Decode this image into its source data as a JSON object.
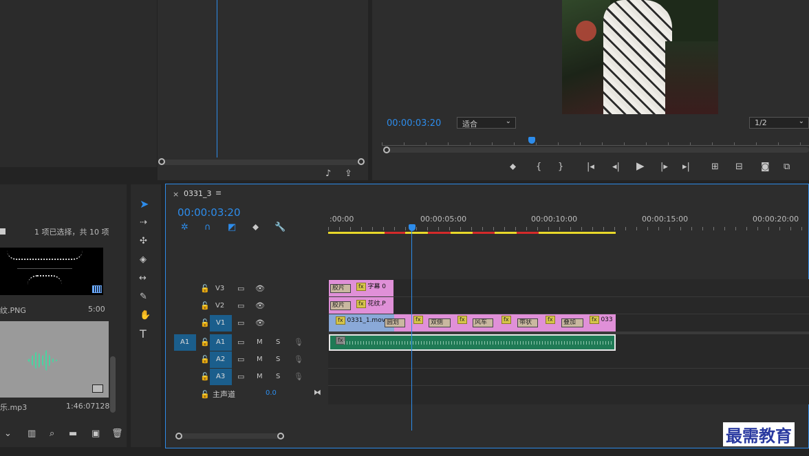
{
  "program_monitor": {
    "timecode": "00:00:03:20",
    "fit_select": "适合",
    "resolution_select": "1/2"
  },
  "project_panel": {
    "selection_status": "1 项已选择，共 10 项",
    "items": [
      {
        "name": "纹.PNG",
        "duration": "5:00"
      },
      {
        "name": "乐.mp3",
        "duration": "1:46:07128"
      }
    ]
  },
  "timeline": {
    "tab_close": "×",
    "sequence_name": "0331_3",
    "menu_icon": "≡",
    "timecode": "00:00:03:20",
    "ruler_labels": [
      ":00:00",
      "00:00:05:00",
      "00:00:10:00",
      "00:00:15:00",
      "00:00:20:00"
    ],
    "video_tracks": [
      {
        "name": "V3",
        "clips": [
          "胶片",
          "字幕 0"
        ]
      },
      {
        "name": "V2",
        "clips": [
          "胶片",
          "花纹.P"
        ]
      },
      {
        "name": "V1",
        "clips": [
          "0331_1.mov",
          "圆划",
          "双侧",
          "风车",
          "带状",
          "叠加",
          "033"
        ]
      }
    ],
    "audio_tracks": [
      {
        "source": "A1",
        "name": "A1",
        "m": "M",
        "s": "S"
      },
      {
        "name": "A2",
        "m": "M",
        "s": "S"
      },
      {
        "name": "A3",
        "m": "M",
        "s": "S"
      }
    ],
    "master": {
      "label": "主声道",
      "value": "0.0"
    },
    "fx_label": "fx"
  },
  "watermark": "最需教育"
}
